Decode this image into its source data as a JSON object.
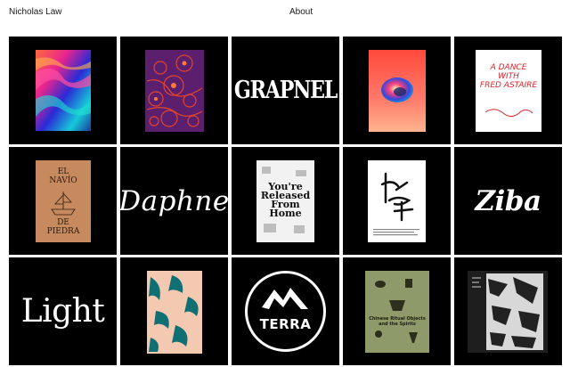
{
  "header": {
    "site_name": "Nicholas Law",
    "about_label": "About"
  },
  "colors": {
    "background": "#ffffff",
    "tile": "#000000",
    "text": "#1a1a1a"
  },
  "tiles": [
    {
      "kind": "gradient-waves-poster"
    },
    {
      "kind": "purple-pattern-poster"
    },
    {
      "kind": "wordmark",
      "text": "GRAPNEL"
    },
    {
      "kind": "gradient-orb-poster"
    },
    {
      "kind": "poster",
      "lines": [
        "A DANCE",
        "WITH",
        "FRED ASTAIRE"
      ]
    },
    {
      "kind": "poster",
      "lines": [
        "EL",
        "NAVÍO",
        "DE",
        "PIEDRA"
      ]
    },
    {
      "kind": "wordmark",
      "text": "Daphne"
    },
    {
      "kind": "poster",
      "lines": [
        "You're",
        "Released",
        "From",
        "Home"
      ]
    },
    {
      "kind": "calligraphy-poster"
    },
    {
      "kind": "wordmark",
      "text": "Ziba"
    },
    {
      "kind": "wordmark",
      "text": "Light"
    },
    {
      "kind": "brush-pattern-poster"
    },
    {
      "kind": "logo",
      "text": "TERRA"
    },
    {
      "kind": "poster",
      "lines": [
        "Chinese Ritual Objects",
        "and the Spirits"
      ]
    },
    {
      "kind": "collage-poster"
    }
  ]
}
